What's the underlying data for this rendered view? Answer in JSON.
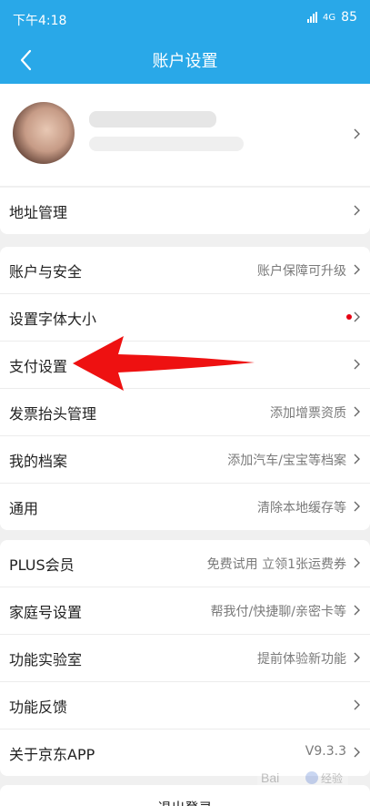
{
  "status_bar": {
    "time": "下午4:18",
    "signal": "4G",
    "battery": "85"
  },
  "header": {
    "title": "账户设置"
  },
  "address": {
    "label": "地址管理"
  },
  "group1": [
    {
      "label": "账户与安全",
      "value": "账户保障可升级"
    },
    {
      "label": "设置字体大小",
      "value": ""
    },
    {
      "label": "支付设置",
      "value": ""
    },
    {
      "label": "发票抬头管理",
      "value": "添加增票资质"
    },
    {
      "label": "我的档案",
      "value": "添加汽车/宝宝等档案"
    },
    {
      "label": "通用",
      "value": "清除本地缓存等"
    }
  ],
  "group2": [
    {
      "label": "PLUS会员",
      "value": "免费试用 立领1张运费券"
    },
    {
      "label": "家庭号设置",
      "value": "帮我付/快捷聊/亲密卡等"
    },
    {
      "label": "功能实验室",
      "value": "提前体验新功能"
    },
    {
      "label": "功能反馈",
      "value": ""
    },
    {
      "label": "关于京东APP",
      "value": "V9.3.3"
    }
  ],
  "bottom_button": "退出登录",
  "watermark": "Bai du 经验",
  "colors": {
    "accent": "#29a8e8",
    "red_dot": "#e60012",
    "annotation_arrow": "#ee1111"
  }
}
